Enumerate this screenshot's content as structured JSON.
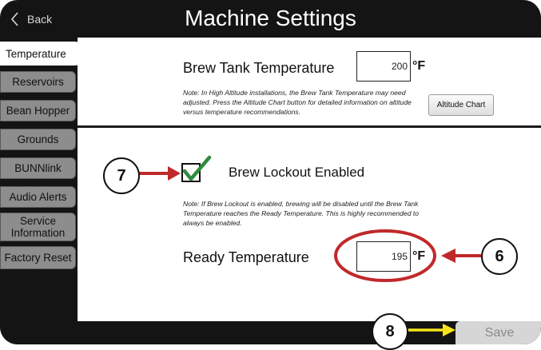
{
  "header": {
    "back_label": "Back",
    "title": "Machine Settings"
  },
  "sidebar": {
    "items": [
      {
        "label": "Temperature",
        "active": true
      },
      {
        "label": "Reservoirs"
      },
      {
        "label": "Bean Hopper"
      },
      {
        "label": "Grounds"
      },
      {
        "label": "BUNNlink"
      },
      {
        "label": "Audio Alerts"
      },
      {
        "label": "Service Information"
      },
      {
        "label": "Factory Reset"
      }
    ]
  },
  "brew_tank": {
    "label": "Brew Tank Temperature",
    "value": "200",
    "unit": "°F",
    "note": "Note:  In High Altitude installations, the Brew Tank Temperature may need adjusted.  Press the Altitude Chart button for detailed information on altitude versus temperature recommendations.",
    "altitude_button": "Altitude Chart"
  },
  "lockout": {
    "label": "Brew Lockout Enabled",
    "checked": true,
    "note": "Note:  If Brew Lockout is enabled, brewing will be disabled until the Brew Tank Temperature reaches the Ready Temperature. This is highly recommended to always be enabled."
  },
  "ready": {
    "label": "Ready Temperature",
    "value": "195",
    "unit": "°F"
  },
  "footer": {
    "save_label": "Save"
  },
  "callouts": {
    "c6": "6",
    "c7": "7",
    "c8": "8"
  },
  "colors": {
    "arrow_red": "#c0292b",
    "arrow_yellow": "#f7e51b",
    "check_green": "#2e8b3d",
    "tab_gray": "#8d8d8d"
  }
}
